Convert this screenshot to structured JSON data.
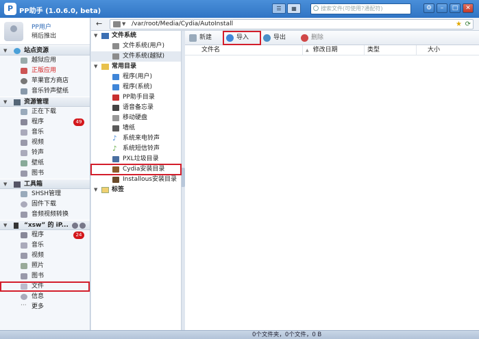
{
  "app": {
    "title": "PP助手 (1.0.6.0, beta)",
    "logo_glyph": "P"
  },
  "search": {
    "placeholder": "搜索文件(可使用?通配符)"
  },
  "user": {
    "name": "PP用户",
    "action": "稍后推出"
  },
  "sidebar": {
    "sections": [
      {
        "title": "站点资源",
        "items": [
          {
            "label": "越狱应用",
            "icon": "app-icon"
          },
          {
            "label": "正版应用",
            "icon": "app-icon",
            "red": true
          },
          {
            "label": "苹果官方商店",
            "icon": "apple-icon"
          },
          {
            "label": "音乐铃声壁纸",
            "icon": "music-icon"
          }
        ]
      },
      {
        "title": "资源管理",
        "items": [
          {
            "label": "正在下载",
            "icon": "download-icon"
          },
          {
            "label": "程序",
            "icon": "apps-icon",
            "badge": "49"
          },
          {
            "label": "音乐",
            "icon": "music-icon"
          },
          {
            "label": "视频",
            "icon": "video-icon"
          },
          {
            "label": "铃声",
            "icon": "ringtone-icon"
          },
          {
            "label": "壁纸",
            "icon": "wallpaper-icon"
          },
          {
            "label": "图书",
            "icon": "book-icon"
          }
        ]
      },
      {
        "title": "工具箱",
        "items": [
          {
            "label": "SHSH管理",
            "icon": "shsh-icon"
          },
          {
            "label": "固件下载",
            "icon": "firmware-icon"
          },
          {
            "label": "音频视频转换",
            "icon": "convert-icon"
          }
        ]
      },
      {
        "title": "“xsw” 的 iP...",
        "items": [
          {
            "label": "程序",
            "icon": "apps-icon",
            "badge": "24"
          },
          {
            "label": "音乐",
            "icon": "music-icon"
          },
          {
            "label": "视频",
            "icon": "video-icon"
          },
          {
            "label": "照片",
            "icon": "photo-icon"
          },
          {
            "label": "图书",
            "icon": "book-icon"
          },
          {
            "label": "文件",
            "icon": "file-icon",
            "highlighted": true
          },
          {
            "label": "信息",
            "icon": "message-icon"
          },
          {
            "label": "更多",
            "icon": "more-icon"
          }
        ]
      }
    ]
  },
  "path": {
    "value": "/var/root/Media/Cydia/AutoInstall"
  },
  "tree": {
    "groups": [
      {
        "title": "文件系统",
        "items": [
          {
            "label": "文件系统(用户)"
          },
          {
            "label": "文件系统(越狱)",
            "selected": true
          }
        ]
      },
      {
        "title": "常用目录",
        "items": [
          {
            "label": "程序(用户)"
          },
          {
            "label": "程序(系统)"
          },
          {
            "label": "PP助手目录"
          },
          {
            "label": "语音备忘录"
          },
          {
            "label": "移动硬盘"
          },
          {
            "label": "墙纸"
          },
          {
            "label": "系统来电铃声"
          },
          {
            "label": "系统短信铃声"
          },
          {
            "label": "PXL垃圾目录"
          },
          {
            "label": "Cydia安装目录",
            "highlighted": true
          },
          {
            "label": "Installous安装目录"
          }
        ]
      },
      {
        "title": "标签",
        "items": []
      }
    ]
  },
  "toolbar": {
    "new": "新建",
    "import": "导入",
    "export": "导出",
    "delete": "删除"
  },
  "columns": {
    "name": "文件名",
    "date": "修改日期",
    "type": "类型",
    "size": "大小"
  },
  "status": {
    "text": "0个文件夹，0个文件，0 B"
  },
  "colors": {
    "titlebar": "#2f74c4",
    "highlight_box": "#d31d2a",
    "badge": "#d3171b"
  }
}
